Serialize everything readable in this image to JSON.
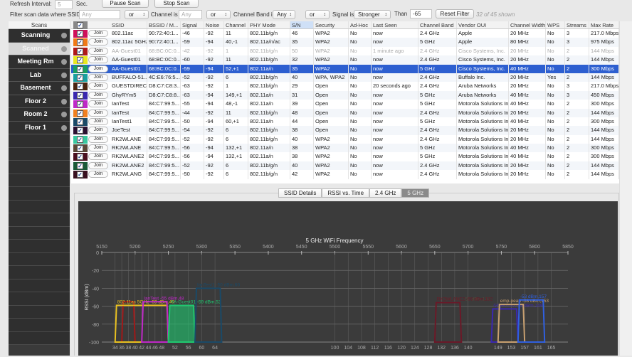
{
  "toolbar": {
    "refresh_label": "Refresh Interval:",
    "refresh_value": "5",
    "sec_label": "Sec.",
    "pause_label": "Pause Scan",
    "stop_label": "Stop Scan"
  },
  "filter": {
    "ssid_label": "Filter scan data where SSID is",
    "ssid_placeholder": "Any",
    "op1": "or",
    "channel_label": "Channel is",
    "channel_placeholder": "Any",
    "op2": "or",
    "band_label": "Channel Band is",
    "band_value": "Any",
    "op3": "or",
    "signal_label": "Signal is",
    "signal_value": "Stronger",
    "than_label": "Than",
    "than_value": "-65",
    "reset_label": "Reset Filter",
    "shown": "32 of 45 shown"
  },
  "sidebar": {
    "header": "Scans",
    "items": [
      {
        "label": "Scanning"
      },
      {
        "label": "Scanned",
        "selected": true
      },
      {
        "label": "Meeting Rm"
      },
      {
        "label": "Lab"
      },
      {
        "label": "Basement"
      },
      {
        "label": "Floor 2"
      },
      {
        "label": "Room 2"
      },
      {
        "label": "Floor 1"
      }
    ]
  },
  "table": {
    "join_label": "Join",
    "columns": [
      "",
      "",
      "SSID",
      "BSSID / M...",
      "Signal",
      "Noise",
      "Channel",
      "PHY Mode",
      "S/N",
      "Security",
      "Ad-Hoc",
      "Last Seen",
      "Channel Band",
      "Vendor OUI",
      "Channel Width",
      "WPS",
      "Streams",
      "Max Rate"
    ],
    "sorted_column": "S/N",
    "rows": [
      {
        "color": "#d0105a",
        "cells": [
          "802.11ac",
          "90:72:40:1...",
          "-46",
          "-92",
          "11",
          "802.11b/g/n",
          "46",
          "WPA2",
          "No",
          "now",
          "2.4 GHz",
          "Apple",
          "20 MHz",
          "No",
          "3",
          "217.0 Mbps"
        ]
      },
      {
        "color": "#f07a18",
        "cells": [
          "802.11ac 5GHz",
          "90:72:40:1...",
          "-59",
          "-94",
          "40,-1",
          "802.11a/n/ac",
          "35",
          "WPA2",
          "No",
          "now",
          "5 GHz",
          "Apple",
          "80 MHz",
          "No",
          "3",
          "975 Mbps"
        ]
      },
      {
        "color": "#b01818",
        "dim": true,
        "cells": [
          "AA-Guest01",
          "68:BC:0C:0...",
          "-42",
          "-92",
          "1",
          "802.11b/g/n",
          "50",
          "WPA2",
          "No",
          "1 minute ago",
          "2.4 GHz",
          "Cisco Systems, Inc.",
          "20 MHz",
          "No",
          "2",
          "144 Mbps"
        ]
      },
      {
        "color": "#e8e820",
        "cells": [
          "AA-Guest01",
          "68:BC:0C:0...",
          "-60",
          "-92",
          "11",
          "802.11b/g/n",
          "32",
          "WPA2",
          "No",
          "now",
          "2.4 GHz",
          "Cisco Systems, Inc.",
          "20 MHz",
          "No",
          "2",
          "144 Mbps"
        ]
      },
      {
        "color": "#18a060",
        "selected": true,
        "cells": [
          "AA-Guest01",
          "68:BC:0C:0...",
          "-59",
          "-94",
          "52,+1",
          "802.11a/n",
          "35",
          "WPA2",
          "No",
          "now",
          "5 GHz",
          "Cisco Systems, Inc.",
          "40 MHz",
          "No",
          "2",
          "300 Mbps"
        ]
      },
      {
        "color": "#18a0a0",
        "cells": [
          "BUFFALO-51...",
          "4C:E6:76:5...",
          "-52",
          "-92",
          "6",
          "802.11b/g/n",
          "40",
          "WPA, WPA2",
          "No",
          "now",
          "2.4 GHz",
          "Buffalo Inc.",
          "20 MHz",
          "Yes",
          "2",
          "144 Mbps"
        ]
      },
      {
        "color": "#4a2410",
        "cells": [
          "GUESTDIRECT",
          "D8:C7:C8:3...",
          "-63",
          "-92",
          "1",
          "802.11b/g/n",
          "29",
          "Open",
          "No",
          "20 seconds ago",
          "2.4 GHz",
          "Aruba Networks",
          "20 MHz",
          "No",
          "3",
          "217.0 Mbps"
        ]
      },
      {
        "color": "#3a28b0",
        "cells": [
          "GhyRYm5",
          "D8:C7:C8:8...",
          "-63",
          "-94",
          "149,+1",
          "802.11a/n",
          "31",
          "Open",
          "No",
          "now",
          "5 GHz",
          "Aruba Networks",
          "40 MHz",
          "No",
          "3",
          "450 Mbps"
        ]
      },
      {
        "color": "#c028c8",
        "cells": [
          "IanTest",
          "84:C7:99:5...",
          "-55",
          "-94",
          "48,-1",
          "802.11a/n",
          "39",
          "Open",
          "No",
          "now",
          "5 GHz",
          "Motorola Solutions Inc.",
          "40 MHz",
          "No",
          "2",
          "300 Mbps"
        ]
      },
      {
        "color": "#f08020",
        "cells": [
          "IanTest",
          "84:C7:99:5...",
          "-44",
          "-92",
          "11",
          "802.11b/g/n",
          "48",
          "Open",
          "No",
          "now",
          "2.4 GHz",
          "Motorola Solutions Inc.",
          "20 MHz",
          "No",
          "2",
          "144 Mbps"
        ]
      },
      {
        "color": "#1a4a68",
        "cells": [
          "IanTest1",
          "84:C7:99:5...",
          "-50",
          "-94",
          "60,+1",
          "802.11a/n",
          "44",
          "Open",
          "No",
          "now",
          "5 GHz",
          "Motorola Solutions Inc.",
          "40 MHz",
          "No",
          "2",
          "300 Mbps"
        ]
      },
      {
        "color": "#2a1030",
        "cells": [
          "JoeTest",
          "84:C7:99:5...",
          "-54",
          "-92",
          "6",
          "802.11b/g/n",
          "38",
          "Open",
          "No",
          "now",
          "2.4 GHz",
          "Motorola Solutions Inc.",
          "20 MHz",
          "No",
          "2",
          "144 Mbps"
        ]
      },
      {
        "color": "#38c8a0",
        "cells": [
          "RK2WLANE",
          "84:C7:99:5...",
          "-52",
          "-92",
          "6",
          "802.11b/g/n",
          "40",
          "WPA2",
          "No",
          "now",
          "2.4 GHz",
          "Motorola Solutions Inc.",
          "20 MHz",
          "No",
          "2",
          "144 Mbps"
        ]
      },
      {
        "color": "#5a4838",
        "cells": [
          "RK2WLANE",
          "84:C7:99:5...",
          "-56",
          "-94",
          "132,+1",
          "802.11a/n",
          "38",
          "WPA2",
          "No",
          "now",
          "5 GHz",
          "Motorola Solutions Inc.",
          "40 MHz",
          "No",
          "2",
          "300 Mbps"
        ]
      },
      {
        "color": "#4a1020",
        "cells": [
          "RK2WLANE2",
          "84:C7:99:5...",
          "-56",
          "-94",
          "132,+1",
          "802.11a/n",
          "38",
          "WPA2",
          "No",
          "now",
          "5 GHz",
          "Motorola Solutions Inc.",
          "40 MHz",
          "No",
          "2",
          "300 Mbps"
        ]
      },
      {
        "color": "#1a5a38",
        "cells": [
          "RK2WLANE2",
          "84:C7:99:5...",
          "-52",
          "-92",
          "6",
          "802.11b/g/n",
          "40",
          "WPA2",
          "No",
          "now",
          "2.4 GHz",
          "Motorola Solutions Inc.",
          "20 MHz",
          "No",
          "2",
          "144 Mbps"
        ]
      },
      {
        "color": "#3a1020",
        "cells": [
          "RK2WLANG",
          "84:C7:99:5...",
          "-50",
          "-92",
          "6",
          "802.11b/g/n",
          "42",
          "WPA2",
          "No",
          "now",
          "2.4 GHz",
          "Motorola Solutions Inc.",
          "20 MHz",
          "No",
          "2",
          "144 Mbps"
        ]
      }
    ]
  },
  "tabs": [
    {
      "label": "SSID Details"
    },
    {
      "label": "RSSI vs. Time"
    },
    {
      "label": "2.4 GHz"
    },
    {
      "label": "5 GHz",
      "active": true
    }
  ],
  "chart_data": {
    "type": "area",
    "title": "5 GHz WiFi Frequency",
    "ylabel": "RSSI (dBm)",
    "xlim": [
      5150,
      5850
    ],
    "ylim": [
      -100,
      0
    ],
    "x_ticks": [
      5150,
      5200,
      5250,
      5300,
      5350,
      5400,
      5450,
      5500,
      5550,
      5600,
      5650,
      5700,
      5750,
      5800,
      5850
    ],
    "y_ticks": [
      0,
      -20,
      -40,
      -60,
      -80,
      -100
    ],
    "channel_ticks": [
      34,
      36,
      38,
      40,
      42,
      44,
      46,
      48,
      52,
      56,
      60,
      64,
      100,
      104,
      108,
      112,
      116,
      120,
      124,
      128,
      132,
      136,
      140,
      149,
      153,
      157,
      161,
      165
    ],
    "grid": true,
    "series": [
      {
        "label": "",
        "lo": 5180,
        "hi": 5200,
        "rssi": -55,
        "color": "#a01818"
      },
      {
        "label": "802.11ac 5GHz -59 dBm,40",
        "lo": 5170,
        "hi": 5250,
        "rssi": -59,
        "color": "#e8c020"
      },
      {
        "label": "IanTest -55 dBm,48",
        "lo": 5210,
        "hi": 5250,
        "rssi": -55,
        "color": "#c028c8"
      },
      {
        "label": "AA-Guest01 -59 dBm,52",
        "lo": 5250,
        "hi": 5290,
        "rssi": -59,
        "color": "#20c870",
        "fill": true
      },
      {
        "label": "IanTest1 -50 dBm,60",
        "lo": 5290,
        "hi": 5330,
        "rssi": -40,
        "color": "#1a4a68"
      },
      {
        "label": "RK2WLANE -56 dBm,132",
        "lo": 5650,
        "hi": 5690,
        "rssi": -56,
        "color": "#5a4838"
      },
      {
        "label": "RK2WLANE2 -56 dBm,132",
        "lo": 5650,
        "hi": 5690,
        "rssi": -56,
        "color": "#6a1828"
      },
      {
        "label": "GhyRYm5 -63 dBm,149",
        "lo": 5735,
        "hi": 5775,
        "rssi": -63,
        "color": "#3a28b0"
      },
      {
        "label": "emp-peap -58 dBm,153",
        "lo": 5745,
        "hi": 5785,
        "rssi": -58,
        "color": "#c8a070"
      },
      {
        "label": "-53 dBm,157",
        "lo": 5775,
        "hi": 5815,
        "rssi": -53,
        "color": "#3060e0"
      }
    ]
  }
}
